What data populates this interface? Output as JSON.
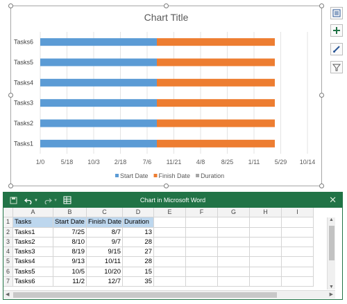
{
  "chart": {
    "title": "Chart Title"
  },
  "chart_data": {
    "type": "bar",
    "orientation": "horizontal",
    "stacked": true,
    "title": "Chart Title",
    "categories": [
      "Tasks1",
      "Tasks2",
      "Tasks3",
      "Tasks4",
      "Tasks5",
      "Tasks6"
    ],
    "series": [
      {
        "name": "Start Date",
        "color": "#5b9bd5",
        "values": [
          "7/25",
          "8/10",
          "8/19",
          "9/13",
          "10/5",
          "11/2"
        ]
      },
      {
        "name": "Finish Date",
        "color": "#ed7d31",
        "values": [
          "8/7",
          "9/7",
          "9/15",
          "10/11",
          "10/20",
          "12/7"
        ]
      },
      {
        "name": "Duration",
        "color": "#a5a5a5",
        "values": [
          13,
          28,
          27,
          28,
          15,
          35
        ]
      }
    ],
    "x_tick_labels": [
      "1/0",
      "5/18",
      "10/3",
      "2/18",
      "7/6",
      "11/21",
      "4/8",
      "8/25",
      "1/11",
      "5/29",
      "10/14"
    ],
    "legend_position": "bottom",
    "grid": true
  },
  "side_tools": [
    "layout-options-icon",
    "chart-elements-icon",
    "chart-styles-icon",
    "chart-filters-icon"
  ],
  "sheet": {
    "title": "Chart in Microsoft Word",
    "close_glyph": "✕",
    "columns": [
      "A",
      "B",
      "C",
      "D",
      "E",
      "F",
      "G",
      "H",
      "I"
    ],
    "rows": [
      [
        "Tasks",
        "Start Date",
        "Finish Date",
        "Duration",
        "",
        "",
        "",
        "",
        ""
      ],
      [
        "Tasks1",
        "7/25",
        "8/7",
        "13",
        "",
        "",
        "",
        "",
        ""
      ],
      [
        "Tasks2",
        "8/10",
        "9/7",
        "28",
        "",
        "",
        "",
        "",
        ""
      ],
      [
        "Tasks3",
        "8/19",
        "9/15",
        "27",
        "",
        "",
        "",
        "",
        ""
      ],
      [
        "Tasks4",
        "9/13",
        "10/11",
        "28",
        "",
        "",
        "",
        "",
        ""
      ],
      [
        "Tasks5",
        "10/5",
        "10/20",
        "15",
        "",
        "",
        "",
        "",
        ""
      ],
      [
        "Tasks6",
        "11/2",
        "12/7",
        "35",
        "",
        "",
        "",
        "",
        ""
      ]
    ],
    "row_numbers": [
      "1",
      "2",
      "3",
      "4",
      "5",
      "6",
      "7"
    ]
  }
}
